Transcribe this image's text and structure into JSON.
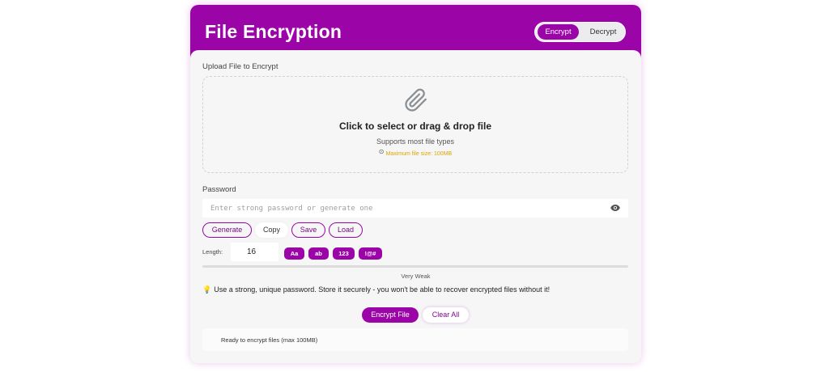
{
  "header": {
    "title": "File Encryption",
    "modes": [
      {
        "label": "Encrypt",
        "active": true
      },
      {
        "label": "Decrypt",
        "active": false
      }
    ],
    "accent_color": "#9b05a8"
  },
  "upload": {
    "label": "Upload File to Encrypt",
    "icon": "paperclip-icon",
    "main_text": "Click to select or drag & drop file",
    "sub_text": "Supports most file types",
    "max_text": "Maximum file size: 100MB"
  },
  "password": {
    "label": "Password",
    "value": "",
    "placeholder": "Enter strong password or generate one",
    "visibility_icon": "eye-icon",
    "buttons": {
      "generate": "Generate",
      "copy": "Copy",
      "save": "Save",
      "load": "Load"
    },
    "length_label": "Length:",
    "length_value": "16",
    "charsets": {
      "upper": "Aa",
      "lower": "ab",
      "digits": "123",
      "symbols": "!@#"
    },
    "strength_label": "Very Weak",
    "strength_fraction": 0.0,
    "tip": "Use a strong, unique password. Store it securely - you won't be able to recover encrypted files without it!"
  },
  "actions": {
    "encrypt": "Encrypt File",
    "clear": "Clear All"
  },
  "status": {
    "text": "Ready to encrypt files (max 100MB)"
  }
}
